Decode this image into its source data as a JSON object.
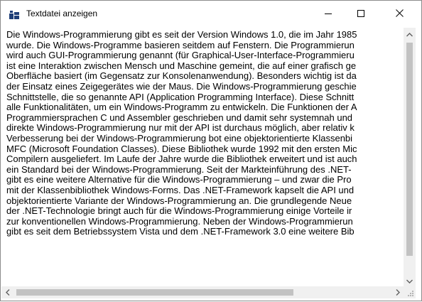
{
  "window": {
    "title": "Textdatei anzeigen",
    "icon": "app-window-icon",
    "controls": {
      "minimize_icon": "minimize-icon",
      "maximize_icon": "maximize-icon",
      "close_icon": "close-icon"
    }
  },
  "textbox": {
    "lines": [
      "Die Windows-Programmierung gibt es seit der Version Windows 1.0, die im Jahr 1985",
      "wurde. Die Windows-Programme basieren seitdem auf Fenstern. Die Programmierun",
      "wird auch GUI-Programmierung genannt (für Graphical-User-Interface-Programmieru",
      "ist eine Interaktion zwischen Mensch und Maschine gemeint, die auf einer grafisch ge",
      "Oberfläche basiert (im Gegensatz zur Konsolenanwendung). Besonders wichtig ist da",
      "der Einsatz eines Zeigegerätes wie der Maus. Die Windows-Programmierung geschie",
      "Schnittstelle, die so genannte API (Application Programming Interface). Diese Schnitt",
      "alle Funktionalitäten, um ein Windows-Programm zu entwickeln. Die Funktionen der A",
      "Programmiersprachen C und Assembler geschrieben und damit sehr systemnah und",
      "direkte Windows-Programmierung nur mit der API ist durchaus möglich, aber relativ k",
      "Verbesserung bei der Windows-Programmierung bot eine objektorientierte Klassenbi",
      "MFC (Microsoft Foundation Classes). Diese Bibliothek wurde 1992 mit den ersten Mic",
      "Compilern ausgeliefert. Im Laufe der Jahre wurde die Bibliothek erweitert und ist auch",
      "ein Standard bei der Windows-Programmierung. Seit der Markteinführung des .NET-",
      "gibt es eine weitere Alternative für die Windows-Programmierung – und zwar die Pro",
      "mit der Klassenbibliothek Windows-Forms. Das .NET-Framework kapselt die API und",
      "objektorientierte Variante der Windows-Programmierung an. Die grundlegende Neue",
      "der .NET-Technologie bringt auch für die Windows-Programmierung einige Vorteile ir",
      "zur konventionellen Windows-Programmierung. Neben der Windows-Programmierun",
      "gibt es seit dem Betriebssystem Vista und dem .NET-Framework 3.0 eine weitere Bib"
    ]
  },
  "scrollbars": {
    "vertical": {
      "up_icon": "arrow-up-icon",
      "down_icon": "arrow-down-icon"
    },
    "horizontal": {
      "left_icon": "arrow-left-icon",
      "right_icon": "arrow-right-icon"
    }
  },
  "colors": {
    "thumb": "#c2c2c2",
    "track": "#f0f0f0",
    "border": "#8c8c8c",
    "icon_blue": "#1f3f78"
  }
}
